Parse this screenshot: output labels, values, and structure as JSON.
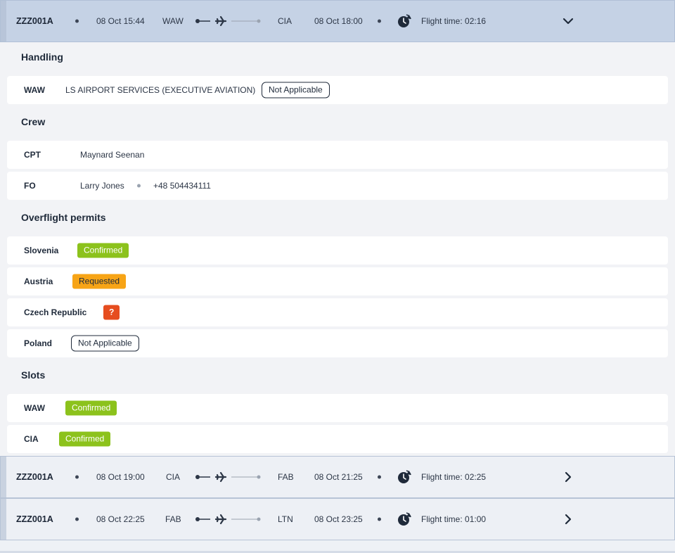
{
  "flights": [
    {
      "code": "ZZZ001A",
      "dep_time": "08 Oct 15:44",
      "from": "WAW",
      "to": "CIA",
      "arr_time": "08 Oct 18:00",
      "duration": "Flight time: 02:16",
      "expanded": true,
      "chevron": "chevron-down-icon"
    },
    {
      "code": "ZZZ001A",
      "dep_time": "08 Oct 19:00",
      "from": "CIA",
      "to": "FAB",
      "arr_time": "08 Oct 21:25",
      "duration": "Flight time: 02:25",
      "expanded": false,
      "chevron": "chevron-right-icon"
    },
    {
      "code": "ZZZ001A",
      "dep_time": "08 Oct 22:25",
      "from": "FAB",
      "to": "LTN",
      "arr_time": "08 Oct 23:25",
      "duration": "Flight time: 01:00",
      "expanded": false,
      "chevron": "chevron-right-icon"
    }
  ],
  "handling": {
    "title": "Handling",
    "items": [
      {
        "airport": "WAW",
        "provider": "LS AIRPORT SERVICES (EXECUTIVE AVIATION)",
        "status": "Not Applicable"
      }
    ]
  },
  "crew": {
    "title": "Crew",
    "members": [
      {
        "role": "CPT",
        "name": "Maynard Seenan",
        "phone": ""
      },
      {
        "role": "FO",
        "name": "Larry Jones",
        "phone": "+48 504434111"
      }
    ]
  },
  "overflight": {
    "title": "Overflight permits",
    "items": [
      {
        "country": "Slovenia",
        "status": "Confirmed"
      },
      {
        "country": "Austria",
        "status": "Requested"
      },
      {
        "country": "Czech Republic",
        "status": "?"
      },
      {
        "country": "Poland",
        "status": "Not Applicable"
      }
    ]
  },
  "slots": {
    "title": "Slots",
    "items": [
      {
        "airport": "WAW",
        "status": "Confirmed"
      },
      {
        "airport": "CIA",
        "status": "Confirmed"
      }
    ]
  },
  "colors": {
    "confirmed": "#8cc21c",
    "requested": "#f7a416",
    "unknown": "#e64d1f",
    "expanded_header": "#c5d2e5"
  }
}
